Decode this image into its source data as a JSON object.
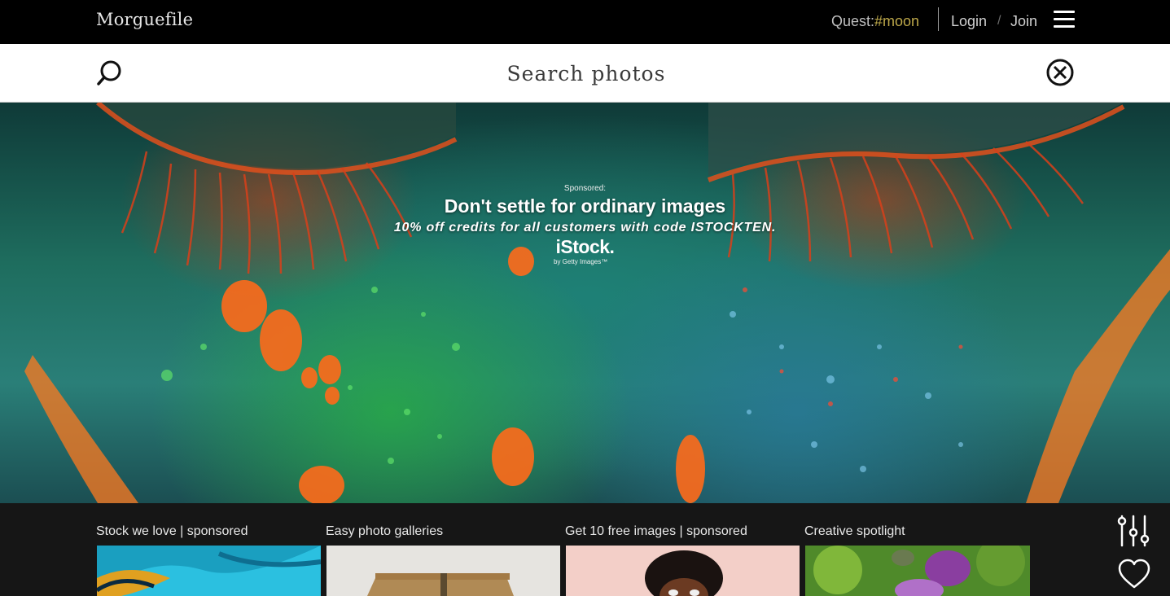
{
  "header": {
    "brand": "Morguefile",
    "quest_label": "Quest:",
    "quest_tag": "#moon",
    "login": "Login",
    "separator": "/",
    "join": "Join",
    "menu_icon": "hamburger-menu-icon"
  },
  "search": {
    "placeholder": "Search photos",
    "value": "",
    "search_icon": "search-icon",
    "close_icon": "close-circle-icon"
  },
  "hero": {
    "sponsored_label": "Sponsored:",
    "headline": "Don't settle for ordinary images",
    "subline": "10% off credits for all customers with code ISTOCKTEN.",
    "logo_text": "iStock.",
    "logo_byline": "by Getty Images™"
  },
  "cards": [
    {
      "title": "Stock we love | sponsored"
    },
    {
      "title": "Easy photo galleries"
    },
    {
      "title": "Get 10 free images | sponsored"
    },
    {
      "title": "Creative spotlight"
    }
  ],
  "side_icons": {
    "filters": "sliders-icon",
    "favorites": "heart-icon"
  },
  "colors": {
    "topbar_bg": "#000000",
    "quest_tag": "#bda84a",
    "bottom_bg": "#161616"
  }
}
